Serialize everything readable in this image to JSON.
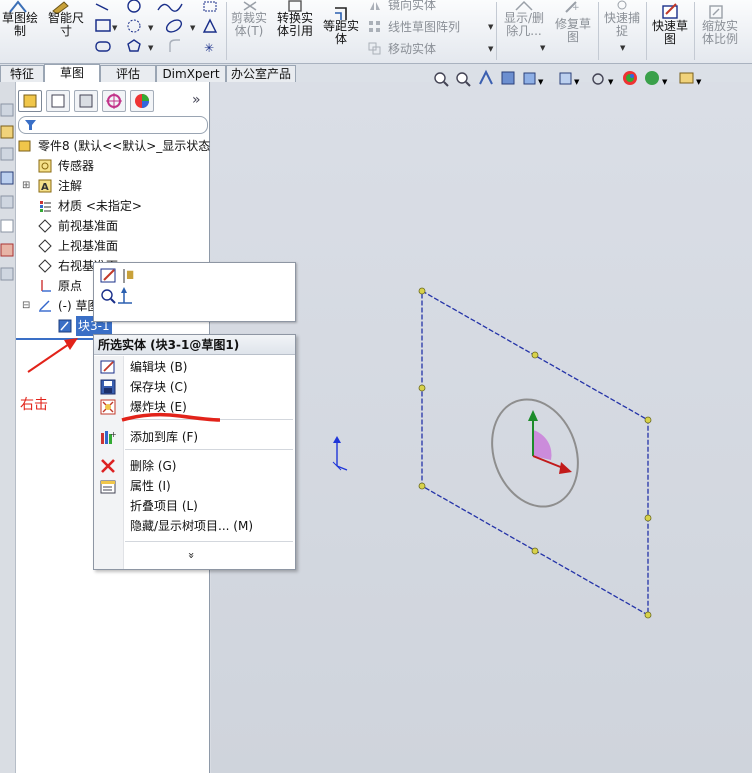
{
  "ribbon": {
    "sketch_button": "草图绘\n制",
    "smart_dim_button": "智能尺\n寸",
    "trim_button": "剪裁实\n体(T)",
    "convert_button": "转换实\n体引用",
    "offset_button": "等距实\n体",
    "mirror_label": "镜向实体",
    "linear_pattern_label": "线性草图阵列",
    "move_entities_label": "移动实体",
    "show_delete_button": "显示/删\n除几...",
    "repair_button": "修复草\n图",
    "quick_snap_button": "快速捕\n捉",
    "rapid_sketch_button": "快速草\n图",
    "scale_button": "缩放实\n体比例"
  },
  "tabs": [
    "特征",
    "草图",
    "评估",
    "DimXpert",
    "办公室产品"
  ],
  "active_tab": "草图",
  "tree": {
    "root": "零件8 (默认<<默认>_显示状态",
    "items": [
      {
        "label": "传感器"
      },
      {
        "label": "注解"
      },
      {
        "label": "材质 <未指定>"
      },
      {
        "label": "前视基准面"
      },
      {
        "label": "上视基准面"
      },
      {
        "label": "右视基准面"
      },
      {
        "label": "原点"
      },
      {
        "label": "(-) 草图"
      },
      {
        "label": "块3-1"
      }
    ]
  },
  "context_menu": {
    "title": "所选实体 (块3-1@草图1)",
    "items": [
      {
        "label": "编辑块 (B)",
        "icon": "edit-block-icon"
      },
      {
        "label": "保存块 (C)",
        "icon": "save-block-icon"
      },
      {
        "label": "爆炸块 (E)",
        "icon": "explode-block-icon"
      },
      {
        "label": "添加到库 (F)",
        "icon": "add-library-icon"
      },
      {
        "label": "删除 (G)",
        "icon": "delete-icon"
      },
      {
        "label": "属性 (I)",
        "icon": "properties-icon"
      },
      {
        "label": "折叠项目 (L)",
        "icon": ""
      },
      {
        "label": "隐藏/显示树项目... (M)",
        "icon": ""
      }
    ],
    "more": "»"
  },
  "annotation": {
    "text": "右击"
  },
  "colors": {
    "accent": "#3a6fc6",
    "annotation": "#e2231a",
    "sketch_line": "#2433a8"
  }
}
